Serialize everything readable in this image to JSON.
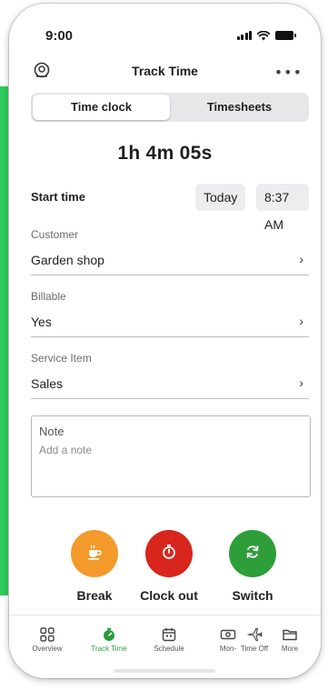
{
  "status_bar": {
    "time": "9:00"
  },
  "header": {
    "title": "Track Time",
    "more": "•••"
  },
  "segments": {
    "active": "Time clock",
    "inactive": "Timesheets"
  },
  "timer": {
    "elapsed": "1h 4m 05s"
  },
  "start": {
    "label": "Start time",
    "date": "Today",
    "time": "8:37 AM"
  },
  "fields": [
    {
      "label": "Customer",
      "value": "Garden shop"
    },
    {
      "label": "Billable",
      "value": "Yes"
    },
    {
      "label": "Service Item",
      "value": "Sales"
    }
  ],
  "chevron": "›",
  "note": {
    "label": "Note",
    "placeholder": "Add a note"
  },
  "actions": [
    {
      "label": "Break",
      "color": "#f39a2a",
      "icon": "coffee-icon"
    },
    {
      "label": "Clock out",
      "color": "#d8261d",
      "icon": "stopwatch-icon"
    },
    {
      "label": "Switch",
      "color": "#2d9e3a",
      "icon": "switch-arrows-icon"
    }
  ],
  "tabs": [
    {
      "label": "Overview",
      "icon": "grid-icon"
    },
    {
      "label": "Track Time",
      "icon": "stopwatch-icon",
      "active": true
    },
    {
      "label": "Schedule",
      "icon": "calendar-icon"
    },
    {
      "label": "Mon-",
      "icon": "money-icon"
    },
    {
      "label": "Time Off",
      "icon": "airplane-icon"
    },
    {
      "label": "More",
      "icon": "folder-icon"
    }
  ],
  "colors": {
    "accent": "#2a9d3c",
    "side_strip": "#2fca5c"
  }
}
